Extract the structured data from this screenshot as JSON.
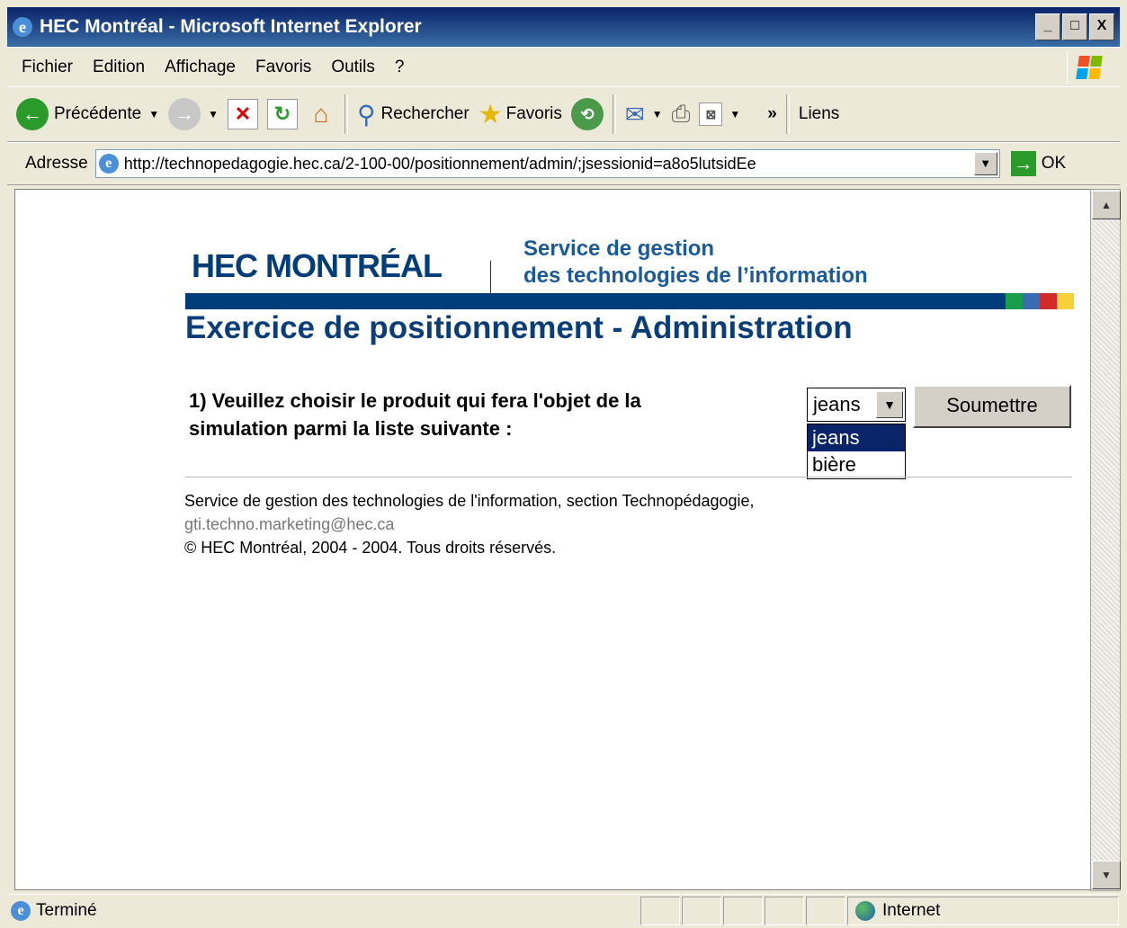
{
  "window": {
    "title": "HEC Montréal - Microsoft Internet Explorer",
    "buttons": [
      "_",
      "□",
      "X"
    ]
  },
  "menu": [
    "Fichier",
    "Edition",
    "Affichage",
    "Favoris",
    "Outils",
    "?"
  ],
  "toolbar": {
    "back": "Précédente",
    "search": "Rechercher",
    "favorites": "Favoris",
    "more": "»",
    "links": "Liens"
  },
  "address": {
    "label": "Adresse",
    "url": "http://technopedagogie.hec.ca/2-100-00/positionnement/admin/;jsessionid=a8o5lutsidEe",
    "go": "OK"
  },
  "page": {
    "logo": "HEC MONTRÉAL",
    "service_line1": "Service de gestion",
    "service_line2": "des technologies de l’information",
    "heading": "Exercice de positionnement - Administration",
    "question_line1": "1) Veuillez choisir le produit qui fera l'objet de la",
    "question_line2": "simulation parmi la liste suivante :",
    "select_value": "jeans",
    "options": [
      "jeans",
      "bière"
    ],
    "submit": "Soumettre",
    "footer_line1": "Service de gestion des technologies de l'information, section Technopédagogie,",
    "footer_email": "gti.techno.marketing@hec.ca",
    "footer_copyright": "© HEC Montréal, 2004 - 2004. Tous droits réservés."
  },
  "colors": {
    "band": "#003d7a",
    "accent_green": "#1a9e4a",
    "accent_blue": "#3a6bb5",
    "accent_red": "#d02a2a",
    "accent_yellow": "#f5d23a"
  },
  "status": {
    "text": "Terminé",
    "zone": "Internet"
  }
}
